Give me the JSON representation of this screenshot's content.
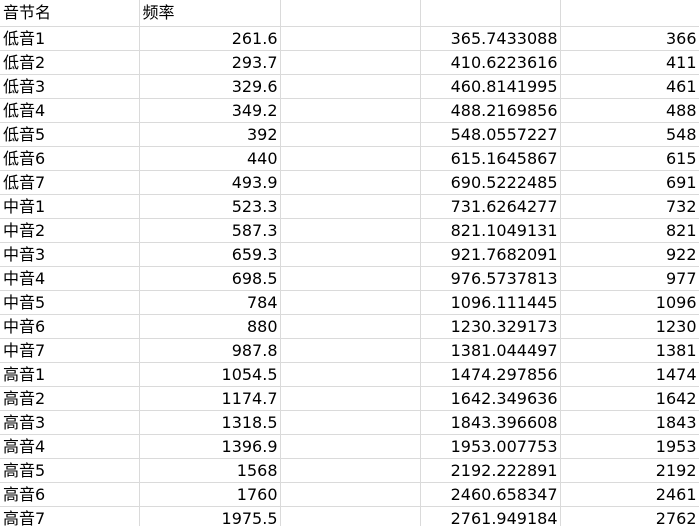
{
  "sheet": {
    "header": {
      "col_a": "音节名",
      "col_b": "频率",
      "col_c": "",
      "col_d": "",
      "col_e": ""
    },
    "rows": [
      {
        "name": "低音1",
        "freq": "261.6",
        "extra": "",
        "scaled": "365.7433088",
        "rounded": "366"
      },
      {
        "name": "低音2",
        "freq": "293.7",
        "extra": "",
        "scaled": "410.6223616",
        "rounded": "411"
      },
      {
        "name": "低音3",
        "freq": "329.6",
        "extra": "",
        "scaled": "460.8141995",
        "rounded": "461"
      },
      {
        "name": "低音4",
        "freq": "349.2",
        "extra": "",
        "scaled": "488.2169856",
        "rounded": "488"
      },
      {
        "name": "低音5",
        "freq": "392",
        "extra": "",
        "scaled": "548.0557227",
        "rounded": "548"
      },
      {
        "name": "低音6",
        "freq": "440",
        "extra": "",
        "scaled": "615.1645867",
        "rounded": "615"
      },
      {
        "name": "低音7",
        "freq": "493.9",
        "extra": "",
        "scaled": "690.5222485",
        "rounded": "691"
      },
      {
        "name": "中音1",
        "freq": "523.3",
        "extra": "",
        "scaled": "731.6264277",
        "rounded": "732"
      },
      {
        "name": "中音2",
        "freq": "587.3",
        "extra": "",
        "scaled": "821.1049131",
        "rounded": "821"
      },
      {
        "name": "中音3",
        "freq": "659.3",
        "extra": "",
        "scaled": "921.7682091",
        "rounded": "922"
      },
      {
        "name": "中音4",
        "freq": "698.5",
        "extra": "",
        "scaled": "976.5737813",
        "rounded": "977"
      },
      {
        "name": "中音5",
        "freq": "784",
        "extra": "",
        "scaled": "1096.111445",
        "rounded": "1096"
      },
      {
        "name": "中音6",
        "freq": "880",
        "extra": "",
        "scaled": "1230.329173",
        "rounded": "1230"
      },
      {
        "name": "中音7",
        "freq": "987.8",
        "extra": "",
        "scaled": "1381.044497",
        "rounded": "1381"
      },
      {
        "name": "高音1",
        "freq": "1054.5",
        "extra": "",
        "scaled": "1474.297856",
        "rounded": "1474"
      },
      {
        "name": "高音2",
        "freq": "1174.7",
        "extra": "",
        "scaled": "1642.349636",
        "rounded": "1642"
      },
      {
        "name": "高音3",
        "freq": "1318.5",
        "extra": "",
        "scaled": "1843.396608",
        "rounded": "1843"
      },
      {
        "name": "高音4",
        "freq": "1396.9",
        "extra": "",
        "scaled": "1953.007753",
        "rounded": "1953"
      },
      {
        "name": "高音5",
        "freq": "1568",
        "extra": "",
        "scaled": "2192.222891",
        "rounded": "2192"
      },
      {
        "name": "高音6",
        "freq": "1760",
        "extra": "",
        "scaled": "2460.658347",
        "rounded": "2461"
      },
      {
        "name": "高音7",
        "freq": "1975.5",
        "extra": "",
        "scaled": "2761.949184",
        "rounded": "2762"
      }
    ]
  }
}
